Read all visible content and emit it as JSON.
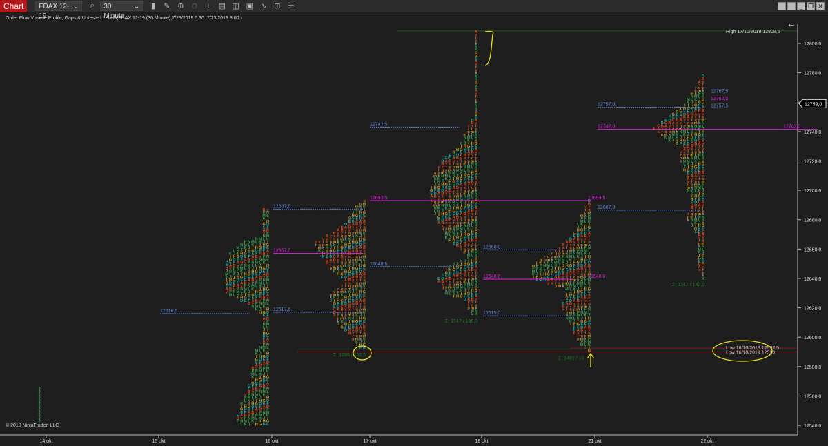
{
  "toolbar": {
    "tab": "Chart",
    "instrument": "FDAX 12-19",
    "interval": "30 Minute",
    "icons": [
      "search-icon",
      "bar-type-icon",
      "pencil-icon",
      "zoom-in-icon",
      "zoom-out-icon",
      "crosshair-icon",
      "properties-icon",
      "templates-icon",
      "snapshot-icon",
      "indicators-icon",
      "strategies-icon",
      "list-icon"
    ]
  },
  "header": {
    "title": "Order Flow Volume Profile, Gaps & Untested Levels(FDAX 12-19 (30 Minute),7/23/2019 5:30 ,7/23/2019 8:00 )"
  },
  "copyright": "© 2019 NinjaTrader, LLC",
  "colors": {
    "background": "#1e1e1e",
    "blue_level": "#5b7fd6",
    "magenta_level": "#e020e0",
    "low_line": "#7a1c1c",
    "high_line": "#1f5a1f",
    "annotation": "#e8e020",
    "sigma": "#1d7a1d"
  },
  "price_axis": {
    "min": 12535,
    "max": 12812,
    "ticks": [
      "12800,0",
      "12780,0",
      "12760,0",
      "12740,0",
      "12720,0",
      "12700,0",
      "12680,0",
      "12660,0",
      "12640,0",
      "12620,0",
      "12600,0",
      "12580,0",
      "12560,0",
      "12540,0"
    ],
    "current_price": "12759,0"
  },
  "date_axis": [
    "14 okt",
    "15 okt",
    "16 okt",
    "17 okt",
    "18 okt",
    "21 okt",
    "22 okt"
  ],
  "reference_lines": [
    {
      "label": "High 17/10/2019 12808,5",
      "price": 12808.5
    },
    {
      "label": "Low 18/10/2019 12592,5",
      "price": 12592.5
    },
    {
      "label": "Low 16/10/2019 12590",
      "price": 12590
    }
  ],
  "levels": [
    {
      "label": "12616,5",
      "price": 12616.5,
      "kind": "blue",
      "day": 1
    },
    {
      "label": "12687,5",
      "price": 12687.5,
      "kind": "blue",
      "day": 2
    },
    {
      "label": "12657,5",
      "price": 12657.5,
      "kind": "magenta",
      "day": 2
    },
    {
      "label": "12617,5",
      "price": 12617.5,
      "kind": "blue",
      "day": 2
    },
    {
      "label": "12743,5",
      "price": 12743.5,
      "kind": "blue",
      "day": 3
    },
    {
      "label": "12693,5",
      "price": 12693.5,
      "kind": "magenta",
      "day": 3
    },
    {
      "label": "12648,5",
      "price": 12648.5,
      "kind": "blue",
      "day": 3
    },
    {
      "label": "12660,0",
      "price": 12660,
      "kind": "blue",
      "day": 4
    },
    {
      "label": "12640,0",
      "price": 12640,
      "kind": "magenta",
      "day": 4
    },
    {
      "label": "12615,0",
      "price": 12615,
      "kind": "blue",
      "day": 4
    },
    {
      "label": "12693,5",
      "price": 12693.5,
      "kind": "magenta",
      "day": 5,
      "end_label": true
    },
    {
      "label": "12640,0",
      "price": 12640,
      "kind": "magenta",
      "day": 5,
      "end_label": true
    },
    {
      "label": "12687,0",
      "price": 12687,
      "kind": "blue",
      "day": 5
    },
    {
      "label": "12757,0",
      "price": 12757,
      "kind": "blue",
      "day": 5
    },
    {
      "label": "12742,0",
      "price": 12742,
      "kind": "magenta",
      "day": 5
    },
    {
      "label": "12742,0",
      "price": 12742,
      "kind": "magenta",
      "day": 6,
      "end_label": true
    },
    {
      "label": "12767,5",
      "price": 12767.5,
      "kind": "blue",
      "day": 6,
      "end_label": true
    },
    {
      "label": "12762,5",
      "price": 12762.5,
      "kind": "magenta",
      "day": 6,
      "end_label": true
    },
    {
      "label": "12757,5",
      "price": 12757.5,
      "kind": "blue",
      "day": 6,
      "end_label": true
    }
  ],
  "profiles": [
    {
      "date": "14 okt",
      "letters": "J",
      "shape": [
        [
          12565,
          1
        ],
        [
          12543,
          1
        ]
      ]
    },
    {
      "date": "16 okt",
      "letters": "FEDGHIJKLMNPyBA",
      "shape": [
        [
          12687,
          2
        ],
        [
          12668,
          2
        ],
        [
          12666,
          6
        ],
        [
          12660,
          10
        ],
        [
          12650,
          12
        ],
        [
          12630,
          12
        ],
        [
          12622,
          5
        ],
        [
          12615,
          2
        ],
        [
          12595,
          2
        ],
        [
          12590,
          4
        ],
        [
          12570,
          5
        ],
        [
          12560,
          7
        ],
        [
          12545,
          9
        ],
        [
          12541,
          8
        ]
      ],
      "sigma": ""
    },
    {
      "date": "17 okt",
      "letters": "kmpqrxyBACDEFGHIJK",
      "shape": [
        [
          12693,
          1
        ],
        [
          12688,
          3
        ],
        [
          12680,
          5
        ],
        [
          12672,
          8
        ],
        [
          12665,
          14
        ],
        [
          12655,
          12
        ],
        [
          12645,
          9
        ],
        [
          12638,
          5
        ],
        [
          12630,
          10
        ],
        [
          12620,
          9
        ],
        [
          12610,
          8
        ],
        [
          12600,
          4
        ],
        [
          12592,
          2
        ]
      ],
      "sigma": "Σ: 1285 / 102,5"
    },
    {
      "date": "18 okt",
      "letters": "kmpqrxyBADEFGHIJKLMN",
      "shape": [
        [
          12808,
          1
        ],
        [
          12750,
          1
        ],
        [
          12742,
          3
        ],
        [
          12730,
          5
        ],
        [
          12722,
          9
        ],
        [
          12710,
          12
        ],
        [
          12695,
          13
        ],
        [
          12680,
          11
        ],
        [
          12665,
          8
        ],
        [
          12655,
          2
        ],
        [
          12650,
          7
        ],
        [
          12640,
          11
        ],
        [
          12630,
          9
        ],
        [
          12625,
          3
        ],
        [
          12615,
          2
        ]
      ],
      "sigma": "Σ: 1747 / 195,0"
    },
    {
      "date": "21 okt",
      "letters": "kmpqrxyBADEFGHIJKLMNP",
      "shape": [
        [
          12693,
          1
        ],
        [
          12680,
          3
        ],
        [
          12670,
          5
        ],
        [
          12660,
          9
        ],
        [
          12650,
          16
        ],
        [
          12640,
          16
        ],
        [
          12632,
          6
        ],
        [
          12620,
          8
        ],
        [
          12605,
          5
        ],
        [
          12595,
          3
        ],
        [
          12590,
          1
        ]
      ],
      "sigma": "Σ: 1491 / 10"
    },
    {
      "date": "22 okt",
      "letters": "kmpqrxyABCDEFGHIJKLMN",
      "shape": [
        [
          12778,
          1
        ],
        [
          12768,
          3
        ],
        [
          12760,
          5
        ],
        [
          12750,
          10
        ],
        [
          12742,
          14
        ],
        [
          12735,
          11
        ],
        [
          12730,
          6
        ],
        [
          12722,
          7
        ],
        [
          12710,
          5
        ],
        [
          12690,
          4
        ],
        [
          12680,
          5
        ],
        [
          12670,
          2
        ],
        [
          12650,
          2
        ],
        [
          12640,
          1
        ]
      ],
      "sigma": "Σ: 1341 / 142,0"
    }
  ]
}
